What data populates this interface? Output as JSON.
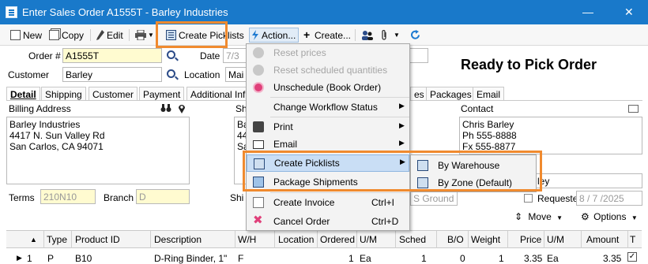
{
  "window": {
    "title": "Enter Sales Order A1555T - Barley Industries",
    "minimize": "—",
    "close": "✕"
  },
  "toolbar": {
    "new": "New",
    "copy": "Copy",
    "edit": "Edit",
    "create_picklists": "Create Picklists",
    "action": "Action...",
    "create": "Create..."
  },
  "form": {
    "order_label": "Order #",
    "order_value": "A1555T",
    "date_label": "Date",
    "date_value": "7/3",
    "customer_label": "Customer",
    "customer_value": "Barley",
    "location_label": "Location",
    "location_value": "Mai",
    "status_text": "Ready to Pick Order"
  },
  "tabs": [
    "Detail",
    "Shipping",
    "Customer",
    "Payment",
    "Additional Inf",
    "es",
    "Packages",
    "Email"
  ],
  "billing": {
    "label": "Billing Address",
    "lines": [
      "Barley Industries",
      "4417 N. Sun Valley Rd",
      "San Carlos, CA 94071"
    ]
  },
  "shipping_partial": {
    "label": "Sh",
    "lines": [
      "Ba",
      "44",
      "Sa"
    ]
  },
  "contact": {
    "label": "Contact",
    "lines": [
      "Chris Barley",
      "Ph 555-8888",
      "Fx 555-8877"
    ],
    "field_tail": "ley"
  },
  "terms": {
    "terms_label": "Terms",
    "terms_value": "210N10",
    "branch_label": "Branch",
    "branch_value": "D",
    "ship_label": "Shi",
    "ship_value": "S Ground",
    "requested_label": "Requested",
    "requested_value": "8 / 7 /2025"
  },
  "grid_actions": {
    "move": "Move",
    "options": "Options"
  },
  "grid": {
    "headers": [
      "Type",
      "Product ID",
      "Description",
      "W/H",
      "Location",
      "Ordered",
      "U/M",
      "Sched",
      "B/O",
      "Weight",
      "Price",
      "U/M",
      "Amount",
      "T"
    ],
    "row": {
      "num": "1",
      "type": "P",
      "product": "B10",
      "description": "D-Ring Binder, 1\"",
      "wh": "F",
      "location": "",
      "ordered": "1",
      "um": "Ea",
      "sched": "1",
      "bo": "0",
      "weight": "1",
      "price": "3.35",
      "um2": "Ea",
      "amount": "3.35",
      "t": "✓"
    }
  },
  "action_menu": {
    "items": [
      {
        "label": "Reset prices",
        "shortcut": "",
        "disabled": true
      },
      {
        "label": "Reset scheduled quantities",
        "shortcut": "",
        "disabled": true
      },
      {
        "label": "Unschedule (Book Order)",
        "shortcut": ""
      },
      {
        "label": "Change Workflow Status",
        "shortcut": "",
        "submenu": true
      },
      {
        "label": "Print",
        "shortcut": "",
        "submenu": true
      },
      {
        "label": "Email",
        "shortcut": "",
        "submenu": true
      },
      {
        "label": "Create Picklists",
        "shortcut": "",
        "submenu": true,
        "selected": true
      },
      {
        "label": "Package Shipments",
        "shortcut": ""
      },
      {
        "label": "Create Invoice",
        "shortcut": "Ctrl+I"
      },
      {
        "label": "Cancel Order",
        "shortcut": "Ctrl+D"
      }
    ]
  },
  "picklist_submenu": {
    "items": [
      "By Warehouse",
      "By Zone (Default)"
    ]
  },
  "colors": {
    "titlebar": "#1979ca",
    "highlight": "#f08a2e",
    "menu_selected": "#c9def5",
    "field_yellow": "#fffbd0"
  }
}
